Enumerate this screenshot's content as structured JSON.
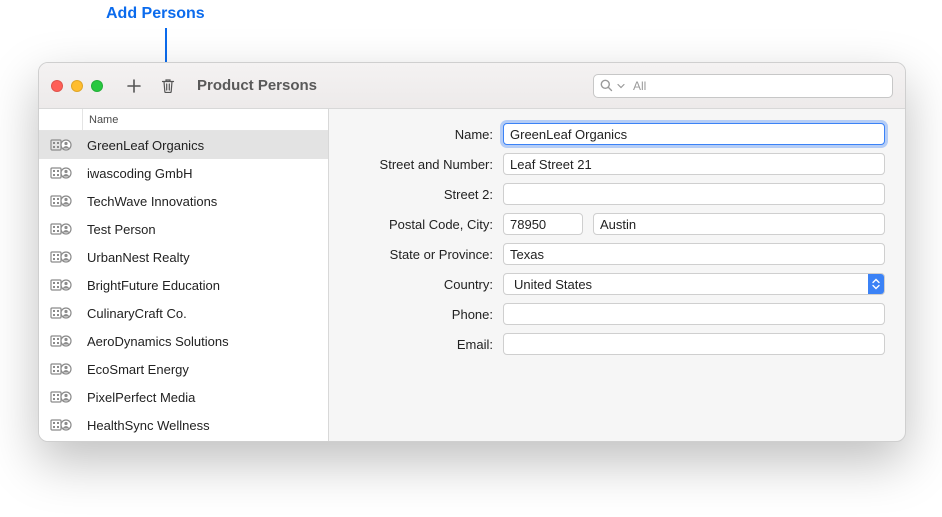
{
  "annotation": {
    "label": "Add Persons"
  },
  "toolbar": {
    "title": "Product Persons",
    "search_placeholder": "All"
  },
  "sidebar": {
    "column_header": "Name",
    "selected_index": 0,
    "items": [
      {
        "name": "GreenLeaf Organics"
      },
      {
        "name": "iwascoding GmbH"
      },
      {
        "name": "TechWave Innovations"
      },
      {
        "name": "Test Person"
      },
      {
        "name": "UrbanNest Realty"
      },
      {
        "name": "BrightFuture Education"
      },
      {
        "name": "CulinaryCraft Co."
      },
      {
        "name": "AeroDynamics Solutions"
      },
      {
        "name": "EcoSmart Energy"
      },
      {
        "name": "PixelPerfect Media"
      },
      {
        "name": "HealthSync Wellness"
      }
    ]
  },
  "form": {
    "labels": {
      "name": "Name:",
      "street1": "Street and Number:",
      "street2": "Street 2:",
      "postal_city": "Postal Code, City:",
      "state": "State or Province:",
      "country": "Country:",
      "phone": "Phone:",
      "email": "Email:"
    },
    "values": {
      "name": "GreenLeaf Organics",
      "street1": "Leaf Street 21",
      "street2": "",
      "postal": "78950",
      "city": "Austin",
      "state": "Texas",
      "country": "United States",
      "phone": "",
      "email": ""
    }
  }
}
